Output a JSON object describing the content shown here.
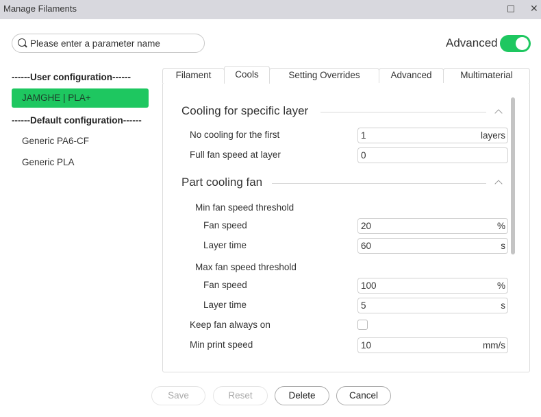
{
  "window": {
    "title": "Manage Filaments"
  },
  "search": {
    "placeholder": "Please enter a parameter name"
  },
  "advanced_toggle": {
    "label": "Advanced",
    "on": true
  },
  "sidebar": {
    "user_header": "------User configuration------",
    "user_items": [
      {
        "label": "JAMGHE | PLA+",
        "selected": true
      }
    ],
    "default_header": "------Default configuration------",
    "default_items": [
      {
        "label": "Generic PA6-CF"
      },
      {
        "label": "Generic PLA"
      }
    ]
  },
  "tabs": [
    {
      "label": "Filament"
    },
    {
      "label": "Cools",
      "active": true
    },
    {
      "label": "Setting Overrides"
    },
    {
      "label": "Advanced"
    },
    {
      "label": "Multimaterial"
    }
  ],
  "sections": {
    "cooling_specific": {
      "title": "Cooling for specific layer",
      "no_cooling": {
        "label": "No cooling for the first",
        "value": "1",
        "unit": "layers"
      },
      "full_fan": {
        "label": "Full fan speed at layer",
        "value": "0",
        "unit": ""
      }
    },
    "part_cooling": {
      "title": "Part cooling fan",
      "min_threshold": "Min fan speed threshold",
      "min_fan_speed": {
        "label": "Fan speed",
        "value": "20",
        "unit": "%"
      },
      "min_layer_time": {
        "label": "Layer time",
        "value": "60",
        "unit": "s"
      },
      "max_threshold": "Max fan speed threshold",
      "max_fan_speed": {
        "label": "Fan speed",
        "value": "100",
        "unit": "%"
      },
      "max_layer_time": {
        "label": "Layer time",
        "value": "5",
        "unit": "s"
      },
      "keep_fan_on": {
        "label": "Keep fan always on",
        "checked": false
      },
      "min_print_speed": {
        "label": "Min print speed",
        "value": "10",
        "unit": "mm/s"
      }
    }
  },
  "buttons": {
    "save": "Save",
    "reset": "Reset",
    "delete": "Delete",
    "cancel": "Cancel"
  },
  "colors": {
    "accent": "#1ec760",
    "titlebar": "#d8d8de"
  }
}
